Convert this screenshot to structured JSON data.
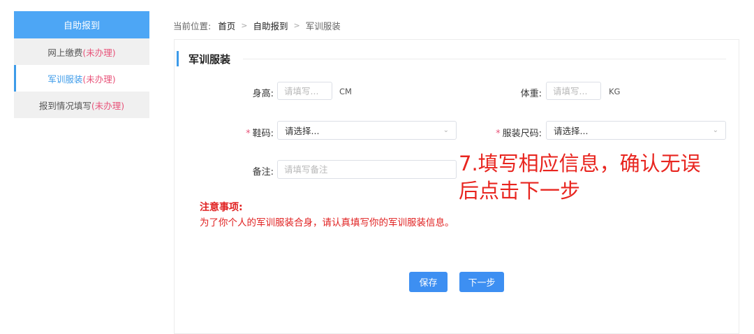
{
  "sidebar": {
    "header": "自助报到",
    "items": [
      {
        "label": "网上缴费",
        "status": "(未办理)"
      },
      {
        "label": "军训服装",
        "status": "(未办理)"
      },
      {
        "label": "报到情况填写",
        "status": "(未办理)"
      }
    ]
  },
  "breadcrumb": {
    "prefix": "当前位置:",
    "items": [
      "首页",
      "自助报到",
      "军训服装"
    ]
  },
  "section": {
    "title": "军训服装"
  },
  "form": {
    "height": {
      "label": "身高:",
      "placeholder": "请填写...",
      "unit": "CM"
    },
    "weight": {
      "label": "体重:",
      "placeholder": "请填写...",
      "unit": "KG"
    },
    "shoe": {
      "required": "*",
      "label": "鞋码:",
      "value": "请选择..."
    },
    "clothing": {
      "required": "*",
      "label": "服装尺码:",
      "value": "请选择..."
    },
    "remark": {
      "label": "备注:",
      "placeholder": "请填写备注"
    }
  },
  "notice": {
    "title": "注意事项:",
    "text": "为了你个人的军训服装合身，请认真填写你的军训服装信息。"
  },
  "buttons": {
    "save": "保存",
    "next": "下一步"
  },
  "annotation": {
    "line1": "7.填写相应信息，确认无误",
    "line2": "后点击下一步"
  },
  "colors": {
    "accent": "#3d9be9",
    "status": "#e8547a",
    "notice": "#e02020",
    "annotation": "#e8251f"
  }
}
